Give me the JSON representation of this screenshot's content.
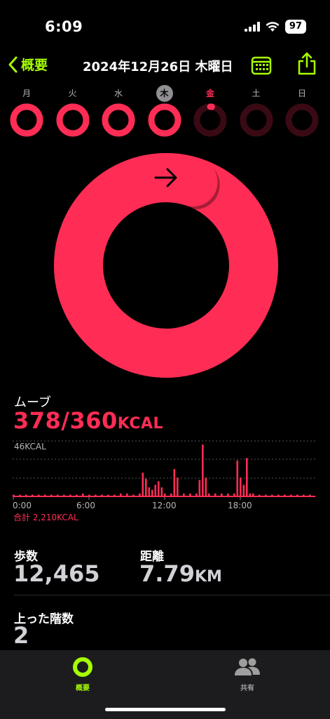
{
  "status": {
    "time": "6:09",
    "battery": "97"
  },
  "nav": {
    "back_label": "概要",
    "date_title": "2024年12月26日 木曜日"
  },
  "week": [
    {
      "label": "月",
      "progress": 1.0,
      "state": "past"
    },
    {
      "label": "火",
      "progress": 1.0,
      "state": "past"
    },
    {
      "label": "水",
      "progress": 1.0,
      "state": "past"
    },
    {
      "label": "木",
      "progress": 1.05,
      "state": "selected"
    },
    {
      "label": "金",
      "progress": 0.02,
      "state": "today"
    },
    {
      "label": "土",
      "progress": 0,
      "state": "future"
    },
    {
      "label": "日",
      "progress": 0,
      "state": "future"
    }
  ],
  "move": {
    "label": "ムーブ",
    "value": "378/360",
    "unit": "KCAL",
    "total": "合計 2,210KCAL",
    "progress": 1.05
  },
  "colors": {
    "move": "#ff2d55",
    "accent": "#a6ff00",
    "ring_track": "#3a0a14"
  },
  "chart_data": {
    "type": "bar",
    "ymax_label": "46KCAL",
    "ylim": [
      0,
      46
    ],
    "x_ticks": [
      "0:00",
      "6:00",
      "12:00",
      "18:00"
    ],
    "x_range_minutes": [
      0,
      1440
    ],
    "bin_minutes": 15,
    "values": [
      2,
      2,
      2,
      2,
      2,
      2,
      2,
      2,
      2,
      2,
      2,
      2,
      2,
      2,
      2,
      2,
      2,
      2,
      2,
      2,
      2,
      2,
      2,
      2,
      2,
      2,
      2,
      2,
      2,
      2,
      2,
      2,
      2,
      2,
      2,
      2,
      2,
      2,
      2,
      2,
      2,
      2,
      2,
      2,
      2,
      2,
      2,
      2,
      2,
      2,
      2,
      2,
      2,
      2,
      2,
      2,
      2,
      2,
      2,
      2,
      2,
      2,
      2,
      2,
      2,
      2,
      2,
      2,
      2,
      2,
      2,
      2,
      2,
      2,
      2,
      2,
      2,
      2,
      2,
      2,
      2,
      2,
      2,
      2,
      2,
      2,
      2,
      2,
      2,
      2,
      2,
      2,
      2,
      2,
      2,
      2,
      2,
      2,
      2,
      2,
      2,
      2,
      2,
      2,
      2,
      2,
      2,
      2,
      2,
      2,
      2,
      2,
      2,
      2,
      2,
      2,
      2,
      2,
      2,
      2,
      2,
      2,
      2,
      2,
      2,
      2,
      2,
      2,
      2,
      2,
      2,
      2,
      2,
      2,
      2,
      2,
      2,
      2,
      2,
      2,
      2,
      2,
      2,
      2,
      2,
      2,
      2,
      2,
      2,
      2,
      2,
      2,
      2,
      2,
      2,
      2,
      2,
      2,
      2,
      2,
      2,
      2,
      2,
      2,
      2,
      2,
      2,
      2,
      2,
      2,
      2,
      2,
      2,
      2,
      2,
      2,
      2,
      2,
      2,
      2,
      2,
      2,
      2,
      2,
      2,
      2,
      2,
      2,
      2,
      2,
      2,
      2,
      2,
      2,
      2,
      2,
      2,
      2,
      2,
      2,
      2,
      2,
      2,
      2,
      2,
      2,
      2,
      2,
      2,
      2,
      2,
      2,
      2,
      2,
      2,
      2,
      2,
      2,
      2,
      2,
      2,
      2,
      2,
      2,
      2,
      2,
      2,
      2,
      2,
      2,
      2,
      2,
      2,
      2,
      2,
      2,
      2,
      2,
      2,
      2,
      2,
      2,
      2,
      2,
      2,
      2,
      2,
      2,
      2,
      2,
      2,
      2,
      2,
      2,
      2,
      2,
      2,
      2,
      2,
      2,
      2,
      2,
      2,
      2,
      2,
      2,
      2,
      2,
      2,
      2,
      2,
      2,
      2,
      2,
      2,
      2,
      2,
      2,
      2,
      2,
      2,
      2,
      2,
      2,
      2,
      2,
      2,
      2,
      2,
      2,
      2,
      2,
      2,
      2,
      2,
      2,
      2,
      2,
      2,
      2,
      2,
      2,
      2,
      2,
      2,
      2,
      2,
      2,
      2,
      2,
      2,
      2,
      2,
      2,
      2,
      2,
      2,
      2,
      2,
      2,
      2,
      2,
      2,
      2,
      2,
      2,
      2,
      2,
      2,
      2,
      2,
      2,
      2,
      2,
      2,
      2,
      2,
      2,
      2,
      2,
      2,
      2,
      2,
      2,
      2,
      2,
      2,
      2,
      2,
      2,
      2,
      2
    ],
    "bars": [
      {
        "minute": 0,
        "value": 2
      },
      {
        "minute": 30,
        "value": 2
      },
      {
        "minute": 60,
        "value": 2
      },
      {
        "minute": 90,
        "value": 2
      },
      {
        "minute": 120,
        "value": 2
      },
      {
        "minute": 150,
        "value": 2
      },
      {
        "minute": 180,
        "value": 2
      },
      {
        "minute": 210,
        "value": 2
      },
      {
        "minute": 240,
        "value": 2
      },
      {
        "minute": 270,
        "value": 2
      },
      {
        "minute": 300,
        "value": 2
      },
      {
        "minute": 330,
        "value": 3
      },
      {
        "minute": 360,
        "value": 2
      },
      {
        "minute": 390,
        "value": 2
      },
      {
        "minute": 420,
        "value": 2
      },
      {
        "minute": 450,
        "value": 2
      },
      {
        "minute": 480,
        "value": 2
      },
      {
        "minute": 510,
        "value": 3
      },
      {
        "minute": 540,
        "value": 3
      },
      {
        "minute": 570,
        "value": 2
      },
      {
        "minute": 600,
        "value": 3
      },
      {
        "minute": 615,
        "value": 20
      },
      {
        "minute": 630,
        "value": 15
      },
      {
        "minute": 645,
        "value": 8
      },
      {
        "minute": 660,
        "value": 6
      },
      {
        "minute": 675,
        "value": 10
      },
      {
        "minute": 690,
        "value": 13
      },
      {
        "minute": 705,
        "value": 8
      },
      {
        "minute": 720,
        "value": 3
      },
      {
        "minute": 750,
        "value": 3
      },
      {
        "minute": 765,
        "value": 23
      },
      {
        "minute": 780,
        "value": 16
      },
      {
        "minute": 810,
        "value": 3
      },
      {
        "minute": 840,
        "value": 3
      },
      {
        "minute": 870,
        "value": 3
      },
      {
        "minute": 885,
        "value": 14
      },
      {
        "minute": 900,
        "value": 43
      },
      {
        "minute": 915,
        "value": 16
      },
      {
        "minute": 930,
        "value": 3
      },
      {
        "minute": 960,
        "value": 3
      },
      {
        "minute": 990,
        "value": 3
      },
      {
        "minute": 1020,
        "value": 3
      },
      {
        "minute": 1050,
        "value": 3
      },
      {
        "minute": 1065,
        "value": 30
      },
      {
        "minute": 1080,
        "value": 16
      },
      {
        "minute": 1095,
        "value": 10
      },
      {
        "minute": 1110,
        "value": 32
      },
      {
        "minute": 1125,
        "value": 3
      },
      {
        "minute": 1140,
        "value": 3
      },
      {
        "minute": 1170,
        "value": 2
      },
      {
        "minute": 1200,
        "value": 2
      },
      {
        "minute": 1230,
        "value": 2
      },
      {
        "minute": 1260,
        "value": 2
      },
      {
        "minute": 1290,
        "value": 2
      },
      {
        "minute": 1320,
        "value": 2
      },
      {
        "minute": 1350,
        "value": 2
      },
      {
        "minute": 1380,
        "value": 2
      },
      {
        "minute": 1410,
        "value": 2
      }
    ]
  },
  "stats": {
    "steps": {
      "label": "歩数",
      "value": "12,465"
    },
    "distance": {
      "label": "距離",
      "value": "7.79",
      "unit": "KM"
    },
    "floors": {
      "label": "上った階数",
      "value": "2"
    }
  },
  "tabs": [
    {
      "label": "概要",
      "active": true
    },
    {
      "label": "共有",
      "active": false
    }
  ]
}
